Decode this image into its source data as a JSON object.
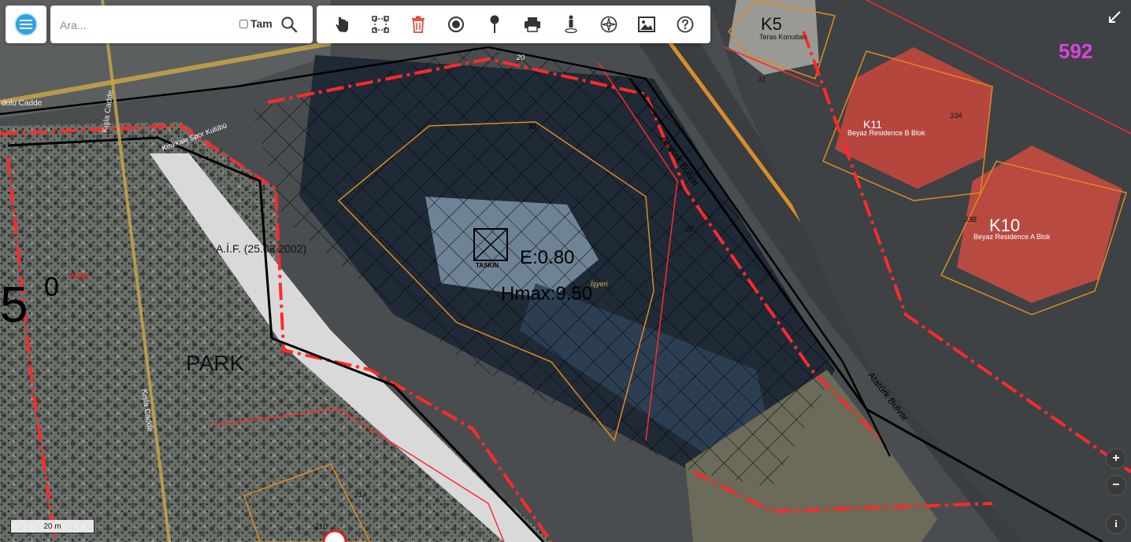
{
  "search": {
    "placeholder": "Ara...",
    "exact_label": "Tam"
  },
  "toolbar": {
    "tools": [
      {
        "name": "pan-hand-icon",
        "label": "pan"
      },
      {
        "name": "select-area-icon",
        "label": "select"
      },
      {
        "name": "delete-icon",
        "label": "delete"
      },
      {
        "name": "record-icon",
        "label": "point"
      },
      {
        "name": "location-pin-icon",
        "label": "pin"
      },
      {
        "name": "print-icon",
        "label": "print"
      },
      {
        "name": "street-view-icon",
        "label": "person"
      },
      {
        "name": "compass-icon",
        "label": "compass"
      },
      {
        "name": "image-icon",
        "label": "image"
      },
      {
        "name": "help-icon",
        "label": "help"
      }
    ]
  },
  "map": {
    "labels": {
      "ataturk_1": "Atatürk Bulvar",
      "ataturk_2": "Atatürk Bulvar",
      "kisla_1": "Kışla Cadde",
      "kisla_2": "Kışla Cadde",
      "anadolu": "dolu Cadde",
      "park": "PARK",
      "park_small": "PARK",
      "aif": "A.İ.F. (25.03.2002)",
      "taskin": "TASKIN",
      "emsal": "E:0.80",
      "hmax": "Hmax:9.50",
      "isyeri": "İşyeri",
      "beyaz_b": "Beyaz Residence B Blok",
      "beyaz_a": "Beyaz Residence A Blok",
      "teras": "Teras Konutları",
      "k5": "K5",
      "k10": "K10",
      "k11": "K11",
      "spor": "Kırıkkale Spor Kulübü",
      "n592": "592",
      "n30": "30",
      "n22": "22",
      "n33a": "33A",
      "n33b": "33B",
      "n21a": "21A",
      "n21b": "21B",
      "n31": "31",
      "n20": "20",
      "big5": "5",
      "big0": "0"
    },
    "scale": "20 m"
  },
  "controls": {
    "zoom_in": "+",
    "zoom_out": "−",
    "info": "i"
  },
  "colors": {
    "parcel_red": "#ff2a2a",
    "road_orange": "#e08a1e",
    "accent_blue": "#2fa3e0",
    "magenta": "#e040e0"
  }
}
